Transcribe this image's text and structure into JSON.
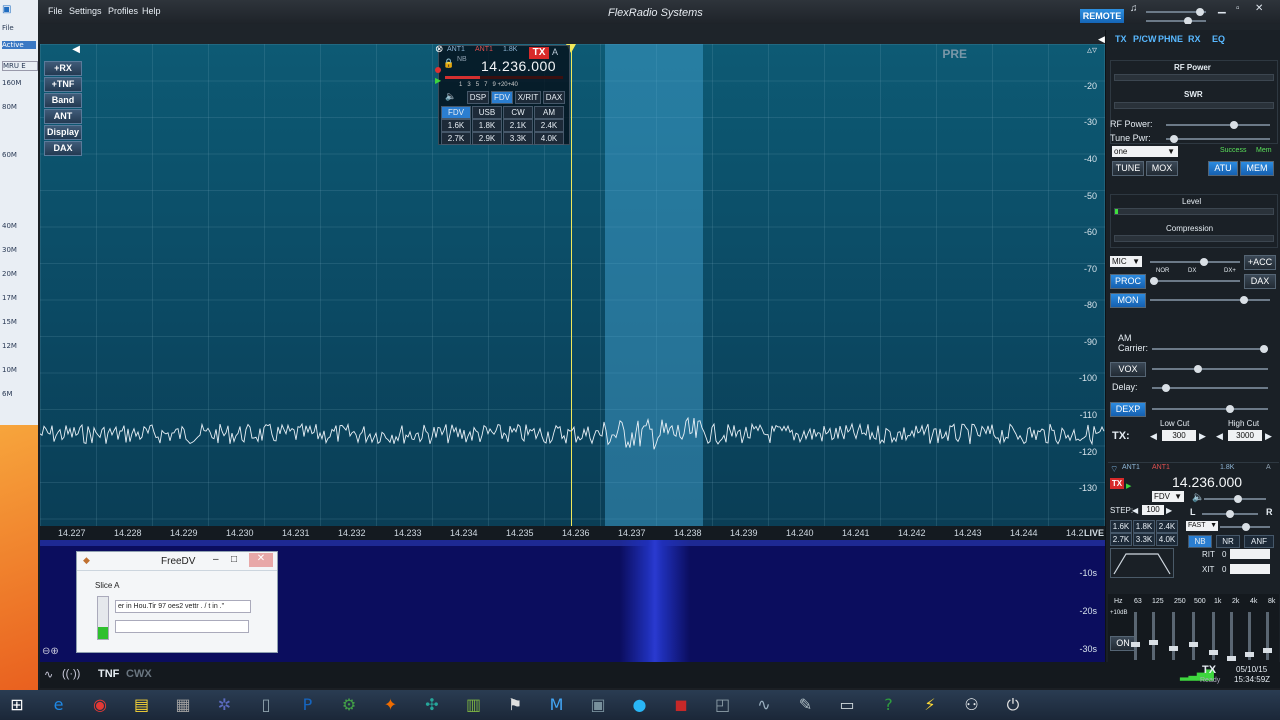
{
  "left_window": {
    "items": [
      "File",
      "Active",
      "MRU E",
      "160M",
      "80M",
      "60M",
      "40M",
      "30M",
      "20M",
      "17M",
      "15M",
      "12M",
      "10M",
      "6M"
    ]
  },
  "title_bar": {
    "menus": [
      "File",
      "Settings",
      "Profiles",
      "Help"
    ],
    "app_title": "FlexRadio Systems",
    "remote_label": "REMOTE"
  },
  "left_nav": {
    "buttons": [
      "+RX",
      "+TNF",
      "Band",
      "ANT",
      "Display",
      "DAX"
    ]
  },
  "panadapter": {
    "pre_label": "PRE",
    "db_labels": [
      "-20",
      "-30",
      "-40",
      "-50",
      "-60",
      "-70",
      "-80",
      "-90",
      "-100",
      "-110",
      "-120",
      "-130"
    ],
    "freq_labels": [
      "14.227",
      "14.228",
      "14.229",
      "14.230",
      "14.231",
      "14.232",
      "14.233",
      "14.234",
      "14.235",
      "14.236",
      "14.237",
      "14.238",
      "14.239",
      "14.240",
      "14.241",
      "14.242",
      "14.243",
      "14.244",
      "14.2"
    ],
    "live_label": "LIVE",
    "waterfall_labels": [
      "-10s",
      "-20s",
      "-30s"
    ]
  },
  "slice_flag": {
    "ant_rx": "ANT1",
    "ant_tx": "ANT1",
    "filter_width": "1.8K",
    "tx_badge": "TX",
    "slice_letter": "A",
    "nb_label": "NB",
    "frequency": "14.236.000",
    "scale_labels": [
      "1",
      "3",
      "5",
      "7",
      "9",
      "+20",
      "+40"
    ],
    "tabs": [
      "DSP",
      "FDV",
      "X/RIT",
      "DAX"
    ],
    "modes": [
      "FDV",
      "USB",
      "CW",
      "AM"
    ],
    "filters_row1": [
      "1.6K",
      "1.8K",
      "2.1K",
      "2.4K"
    ],
    "filters_row2": [
      "2.7K",
      "2.9K",
      "3.3K",
      "4.0K"
    ]
  },
  "right_panel": {
    "tabs": [
      "TX",
      "P/CW",
      "PHNE",
      "RX",
      "EQ"
    ],
    "rf_power_meter": "RF Power",
    "swr_meter": "SWR",
    "rf_power_label": "RF Power:",
    "tune_pwr_label": "Tune Pwr:",
    "profile_select": "one",
    "success_label": "Success",
    "mem_small": "Mem",
    "tune_button": "TUNE",
    "mox_button": "MOX",
    "atu_button": "ATU",
    "mem_button": "MEM",
    "level_label": "Level",
    "compression_label": "Compression",
    "mic_select": "MIC",
    "acc_button": "+ACC",
    "dax_button": "DAX",
    "proc_button": "PROC",
    "nor_label": "NOR",
    "dx_label": "DX",
    "dxplus_label": "DX+",
    "mon_button": "MON",
    "am_carrier_label": "AM Carrier:",
    "vox_button": "VOX",
    "delay_label": "Delay:",
    "dexp_button": "DEXP",
    "low_cut_label": "Low Cut",
    "high_cut_label": "High Cut",
    "tx_label": "TX:",
    "low_cut_value": "300",
    "high_cut_value": "3000"
  },
  "slice_b_panel": {
    "ant_rx": "ANT1",
    "ant_tx": "ANT1",
    "width": "1.8K",
    "slice": "A",
    "tx_badge": "TX",
    "frequency": "14.236.000",
    "mode": "FDV",
    "step_label": "STEP:",
    "step_value": "100",
    "filters": [
      "1.6K",
      "1.8K",
      "2.4K",
      "2.7K",
      "3.3K",
      "4.0K"
    ],
    "l_label": "L",
    "r_label": "R",
    "agc": "FAST",
    "nb": "NB",
    "nr": "NR",
    "anf": "ANF",
    "rit_label": "RIT",
    "xit_label": "XIT",
    "rit_value": "0",
    "xit_value": "0",
    "eq_labels": [
      "Hz",
      "63",
      "125",
      "250",
      "500",
      "1k",
      "2k",
      "4k",
      "8k"
    ],
    "eq_top": "+10dB",
    "on_button": "ON"
  },
  "freedv": {
    "title": "FreeDV",
    "slice_label": "Slice A",
    "text": "er in Hou.Tir 97 oes2 vettr . / t in .\""
  },
  "status_bar": {
    "tnf": "TNF",
    "cwx": "CWX",
    "tx_status": "TX",
    "ready": "Ready",
    "date": "05/10/15",
    "time": "15:34:59Z"
  },
  "taskbar": {
    "icons": [
      "start-icon",
      "ie-icon",
      "chrome-icon",
      "explorer-icon",
      "app-icon",
      "settings-icon",
      "notepad-icon",
      "powerpoint-icon",
      "tools-icon",
      "game-icon",
      "browser-icon",
      "excel-icon",
      "flex-icon",
      "mail-icon",
      "monitor-icon",
      "globe-icon",
      "pdf-icon",
      "chart-icon",
      "wave-icon",
      "tools2-icon",
      "book-icon",
      "help-icon",
      "lightning-icon",
      "binoculars-icon",
      "power-icon"
    ]
  }
}
